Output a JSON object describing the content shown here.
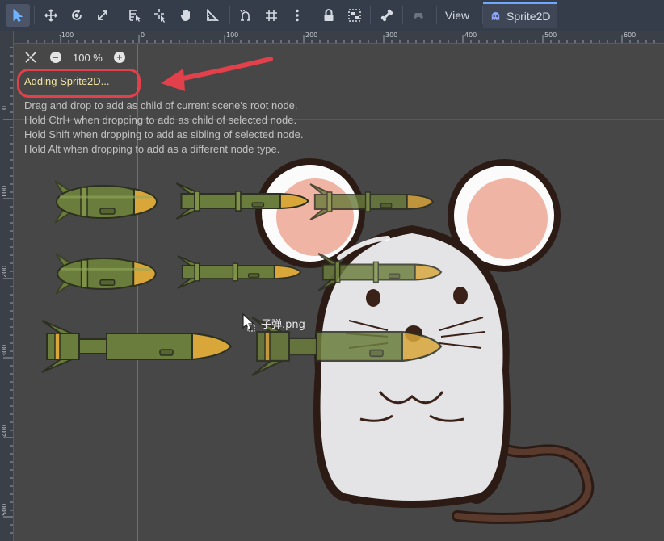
{
  "toolbar": {
    "tools": [
      {
        "name": "select-tool-button",
        "icon": "arrow-cursor-icon",
        "active": true
      },
      {
        "name": "move-tool-button",
        "icon": "move-icon"
      },
      {
        "name": "rotate-tool-button",
        "icon": "rotate-icon"
      },
      {
        "name": "scale-tool-button",
        "icon": "scale-icon"
      },
      {
        "name": "list-select-button",
        "icon": "list-select-icon"
      },
      {
        "name": "pivot-tool-button",
        "icon": "pivot-icon"
      },
      {
        "name": "pan-tool-button",
        "icon": "hand-icon"
      },
      {
        "name": "ruler-tool-button",
        "icon": "ruler-icon"
      },
      {
        "name": "smart-snap-button",
        "icon": "snap-icon"
      },
      {
        "name": "grid-snap-button",
        "icon": "grid-icon"
      },
      {
        "name": "snap-options-button",
        "icon": "kebab-icon"
      },
      {
        "name": "lock-button",
        "icon": "lock-icon"
      },
      {
        "name": "group-button",
        "icon": "group-icon"
      },
      {
        "name": "bones-button",
        "icon": "bone-icon"
      },
      {
        "name": "camera-override-button",
        "icon": "gamepad-icon"
      }
    ],
    "view_label": "View",
    "tab_label": "Sprite2D"
  },
  "rulers": {
    "top_labels": [
      "-100",
      "0",
      "100",
      "200",
      "300",
      "400",
      "500",
      "600"
    ],
    "left_labels": [
      "0",
      "100",
      "200",
      "300",
      "400",
      "500"
    ]
  },
  "zoom": {
    "value": "100 %"
  },
  "status": {
    "adding_label": "Adding Sprite2D...",
    "hints": [
      "Drag and drop to add as child of current scene's root node.",
      "Hold Ctrl+ when dropping to add as child of selected node.",
      "Hold Shift when dropping to add as sibling of selected node.",
      "Hold Alt when dropping to add as a different node type."
    ]
  },
  "drag": {
    "file_name": "子弹.png"
  },
  "colors": {
    "accent": "#6fa8ff",
    "annotation": "#e2404a",
    "missile_body": "#6b7d3c",
    "missile_tip": "#d9a63a",
    "mouse_body": "#e8e8ea",
    "mouse_ear": "#f4b7a6"
  }
}
